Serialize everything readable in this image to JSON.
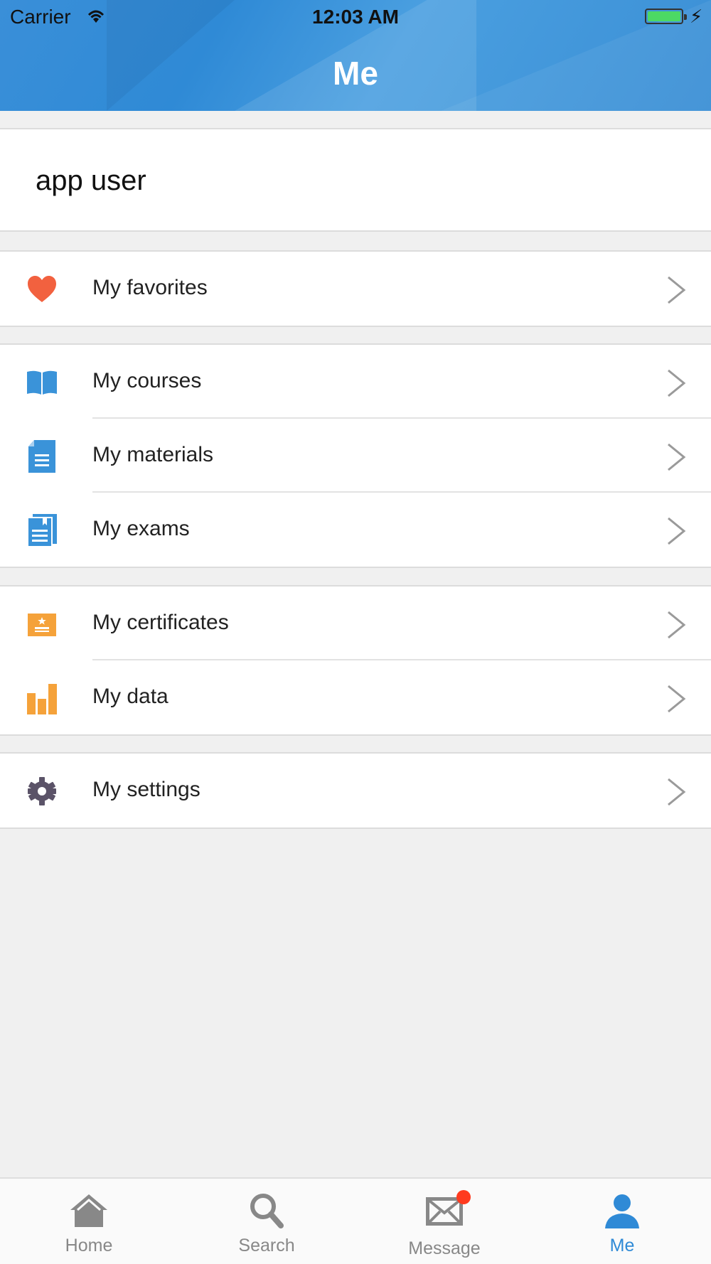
{
  "status_bar": {
    "carrier": "Carrier",
    "time": "12:03 AM"
  },
  "nav": {
    "title": "Me"
  },
  "user": {
    "name": "app user"
  },
  "menu": {
    "favorites": {
      "label": "My favorites",
      "icon": "heart-icon",
      "color": "#f2613f"
    },
    "courses": {
      "label": "My courses",
      "icon": "book-icon",
      "color": "#3a93d9"
    },
    "materials": {
      "label": "My materials",
      "icon": "document-icon",
      "color": "#3a93d9"
    },
    "exams": {
      "label": "My exams",
      "icon": "exam-icon",
      "color": "#3a93d9"
    },
    "certificates": {
      "label": "My certificates",
      "icon": "certificate-icon",
      "color": "#f5a23a"
    },
    "data": {
      "label": "My data",
      "icon": "bar-chart-icon",
      "color": "#f5a23a"
    },
    "settings": {
      "label": "My settings",
      "icon": "gear-icon",
      "color": "#5b5368"
    }
  },
  "tabbar": {
    "home": "Home",
    "search": "Search",
    "message": "Message",
    "me": "Me",
    "active": "me",
    "active_color": "#2f8ad6",
    "message_badge": true
  }
}
